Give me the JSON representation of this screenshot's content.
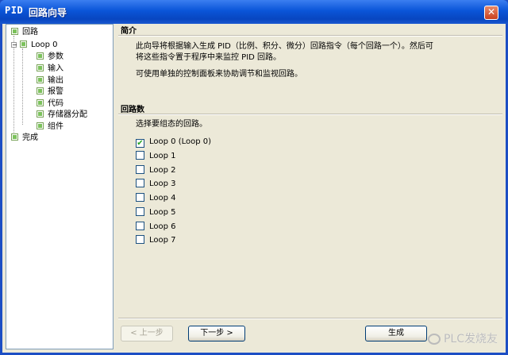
{
  "window": {
    "title_icon": "PID",
    "title": "回路向导"
  },
  "tree": {
    "root": "回路",
    "loop": "Loop 0",
    "children": [
      "参数",
      "输入",
      "输出",
      "报警",
      "代码",
      "存储器分配",
      "组件"
    ],
    "finish": "完成"
  },
  "intro": {
    "heading": "简介",
    "line1": "此向导将根据输入生成 PID（比例、积分、微分）回路指令（每个回路一个）。然后可",
    "line2": "将这些指令置于程序中来监控 PID 回路。",
    "line3": "可使用单独的控制面板来协助调节和监视回路。"
  },
  "loops": {
    "heading": "回路数",
    "prompt": "选择要组态的回路。",
    "items": [
      {
        "label": "Loop 0 (Loop 0)",
        "checked": true
      },
      {
        "label": "Loop 1",
        "checked": false
      },
      {
        "label": "Loop 2",
        "checked": false
      },
      {
        "label": "Loop 3",
        "checked": false
      },
      {
        "label": "Loop 4",
        "checked": false
      },
      {
        "label": "Loop 5",
        "checked": false
      },
      {
        "label": "Loop 6",
        "checked": false
      },
      {
        "label": "Loop 7",
        "checked": false
      }
    ]
  },
  "buttons": {
    "prev": "< 上一步",
    "next": "下一步 >",
    "finish": "生成"
  },
  "watermark": "PLC发烧友",
  "colors": {
    "titlebar": "#0a55d8",
    "client": "#ece9d8",
    "tree_icon": "#7cc25c"
  }
}
